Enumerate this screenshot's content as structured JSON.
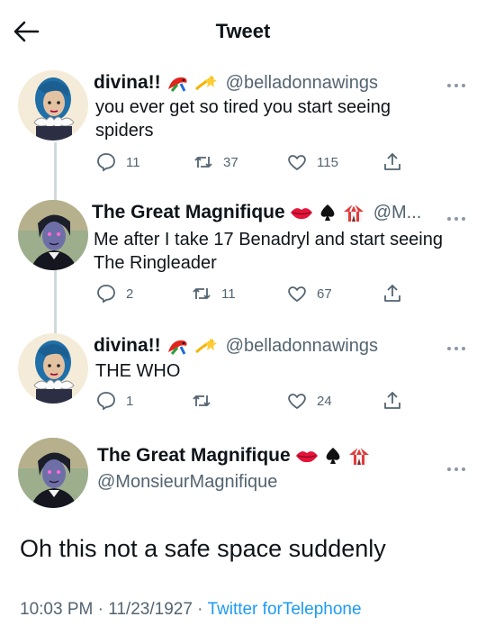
{
  "header": {
    "title": "Tweet"
  },
  "colors": {
    "accent": "#1d9bf0",
    "muted": "#536471",
    "text": "#0f1419",
    "thread_line": "#cfd9de"
  },
  "tweets": [
    {
      "display_name": "divina!!",
      "name_emojis": [
        "parrot-emoji",
        "dizzy-star-emoji"
      ],
      "handle": "@belladonnawings",
      "lines": [
        "you ever get so tired you start seeing",
        "spiders"
      ],
      "replies": "11",
      "retweets": "37",
      "likes": "115"
    },
    {
      "display_name": "The Great Magnifique",
      "name_emojis": [
        "lips-emoji",
        "spade-suit-emoji",
        "circus-tent-emoji"
      ],
      "handle": "@M...",
      "lines": [
        "Me after I take 17 Benadryl and start seeing",
        "The Ringleader"
      ],
      "replies": "2",
      "retweets": "11",
      "likes": "67"
    },
    {
      "display_name": "divina!!",
      "name_emojis": [
        "parrot-emoji",
        "dizzy-star-emoji"
      ],
      "handle": "@belladonnawings",
      "lines": [
        "THE WHO"
      ],
      "replies": "1",
      "retweets": "",
      "likes": "24"
    }
  ],
  "main_tweet": {
    "display_name": "The Great Magnifique",
    "name_emojis": [
      "lips-emoji",
      "spade-suit-emoji",
      "circus-tent-emoji"
    ],
    "handle": "@MonsieurMagnifique",
    "text": "Oh this not a safe space suddenly",
    "time": "10:03 PM · 11/23/1927 ·",
    "source": "Twitter forTelephone"
  }
}
